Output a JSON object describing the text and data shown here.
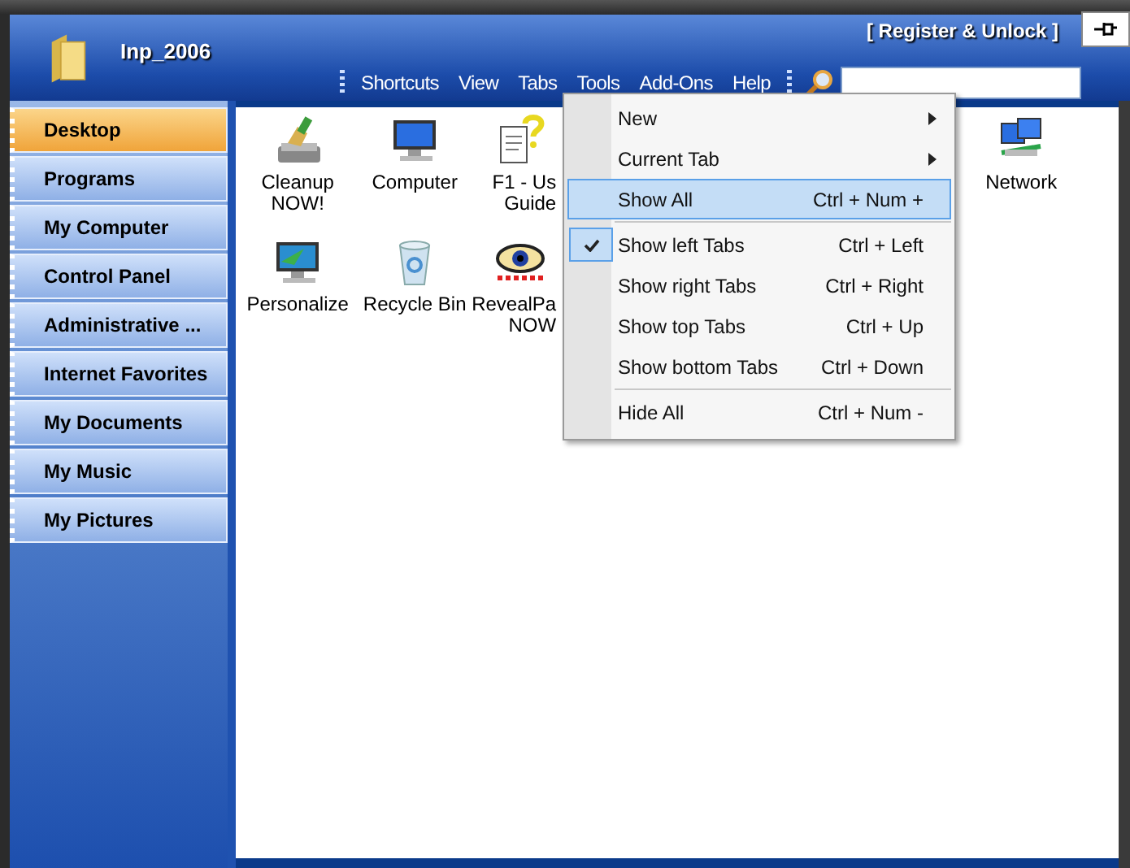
{
  "app": {
    "title": "Inp_2006",
    "register": "[ Register & Unlock ]"
  },
  "menu_bar": [
    {
      "label": "Shortcuts"
    },
    {
      "label": "View"
    },
    {
      "label": "Tabs"
    },
    {
      "label": "Tools"
    },
    {
      "label": "Add-Ons"
    },
    {
      "label": "Help"
    }
  ],
  "sidebar": [
    {
      "label": "Desktop",
      "selected": true
    },
    {
      "label": "Programs",
      "selected": false
    },
    {
      "label": "My Computer",
      "selected": false
    },
    {
      "label": "Control Panel",
      "selected": false
    },
    {
      "label": "Administrative ...",
      "selected": false
    },
    {
      "label": "Internet Favorites",
      "selected": false
    },
    {
      "label": "My Documents",
      "selected": false
    },
    {
      "label": "My Music",
      "selected": false
    },
    {
      "label": "My Pictures",
      "selected": false
    }
  ],
  "icons": [
    {
      "label": "Cleanup NOW!",
      "kind": "cleanup"
    },
    {
      "label": "Computer",
      "kind": "computer"
    },
    {
      "label": "F1 - Us\nGuide",
      "kind": "help"
    },
    {
      "label": "Network",
      "kind": "network"
    },
    {
      "label": "Personalize",
      "kind": "personalize"
    },
    {
      "label": "Recycle Bin",
      "kind": "recycle"
    },
    {
      "label": "RevealPa\nNOW",
      "kind": "eye"
    }
  ],
  "tabs_menu": [
    {
      "label": "New",
      "submenu": true,
      "selected": false,
      "checked": false
    },
    {
      "label": "Current Tab",
      "submenu": true,
      "selected": false,
      "checked": false
    },
    {
      "label": "Show All",
      "shortcut": "Ctrl + Num +",
      "selected": true,
      "checked": false,
      "separator_after": true
    },
    {
      "label": "Show left Tabs",
      "shortcut": "Ctrl + Left",
      "selected": false,
      "checked": true
    },
    {
      "label": "Show right Tabs",
      "shortcut": "Ctrl + Right",
      "selected": false,
      "checked": false
    },
    {
      "label": "Show top Tabs",
      "shortcut": "Ctrl + Up",
      "selected": false,
      "checked": false
    },
    {
      "label": "Show bottom Tabs",
      "shortcut": "Ctrl + Down",
      "selected": false,
      "checked": false,
      "separator_after": true
    },
    {
      "label": "Hide All",
      "shortcut": "Ctrl + Num -",
      "selected": false,
      "checked": false
    }
  ]
}
